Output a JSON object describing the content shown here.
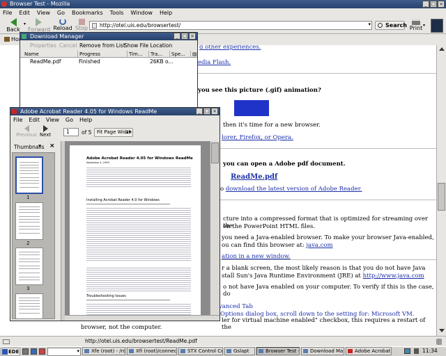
{
  "mozilla": {
    "title": "Browser Test - Mozilla",
    "menu": [
      "File",
      "Edit",
      "View",
      "Go",
      "Bookmarks",
      "Tools",
      "Window",
      "Help"
    ],
    "toolbar": {
      "back": "Back",
      "forward": "Forward",
      "reload": "Reload",
      "stop": "Stop",
      "search": "Search",
      "print": "Print"
    },
    "url": "http://otel.uis.edu/browsertest/",
    "home": "Hom",
    "status": "http://otel.uis.edu/browsertest/ReadMe.pdf"
  },
  "page": {
    "top_link": "d other experiences.",
    "flash": "edia Flash.",
    "gif_q": "you see this picture (.gif) animation?",
    "new_browser": "then it's time for a new browser.",
    "browsers": "lorer, Firefox, or Opera.",
    "pdf_q": "you can open a Adobe pdf document.",
    "readme": "ReadMe.pdf",
    "adobe_pre": "o ",
    "adobe": "download the latest version of Adobe Reader.",
    "ppt1": "cture into a compressed format that is optimized for streaming over the",
    "ppt2": "en the PowerPoint HTML files.",
    "java1": "you need a Java-enabled browser. To make your browser Java-enabled,",
    "java2": "ou can find this browser at:",
    "java_link": "java.com",
    "java_window": "ation in a new window.",
    "blank1": "r a blank screen, the most likely reason is that you do not have Java",
    "blank2": "stall Sun's Java Runtime Environment (JRE) at",
    "jre_link": "http://www.java.com",
    "verify": "o not have Java enabled on your computer. To verify if this is the case, do",
    "adv": "vanced Tab",
    "opt": "Options dialog box, scroll down to the setting for: Microsoft VM.",
    "jit1": "ler for virtual machine enabled\" checkbox, this requires a restart of the",
    "jit2": "browser, not the computer."
  },
  "download_manager": {
    "title": "Download Manager",
    "buttons": {
      "properties": "Properties",
      "cancel": "Cancel",
      "remove": "Remove from List",
      "show": "Show File Location"
    },
    "columns": [
      "Name",
      "Progress",
      "Tim...",
      "Tra...",
      "Spe..."
    ],
    "rows": [
      {
        "name": "ReadMe.pdf",
        "progress": "Finished",
        "time": "",
        "transferred": "26KB o...",
        "speed": ""
      }
    ]
  },
  "acrobat": {
    "title": "Adobe Acrobat Reader 4.05 for Windows ReadMe",
    "menu": [
      "File",
      "Edit",
      "View",
      "Go",
      "Help"
    ],
    "previous": "Previous",
    "next": "Next",
    "page": "1",
    "of": "of 5",
    "fit": "Fit Page Width",
    "thumbnails": "Thumbnails",
    "thumb_nums": [
      "1",
      "2",
      "3"
    ],
    "doc_title": "Adobe Acrobat Reader 4.05 for Windows ReadMe",
    "doc_date": "November 4, 1999",
    "doc_h1": "Installing Acrobat Reader 4.0 for Windows",
    "doc_h2": "Troubleshooting Issues"
  },
  "taskbar": {
    "start": "EDE",
    "tasks": [
      "Xfe (root) - /roo",
      "Xfi (root)/connecti",
      "STX Control Centr",
      "Gslapt",
      "Browser Test - Mc",
      "Download Manag",
      "Adobe Acrobat Re"
    ],
    "clock": "11:34"
  }
}
